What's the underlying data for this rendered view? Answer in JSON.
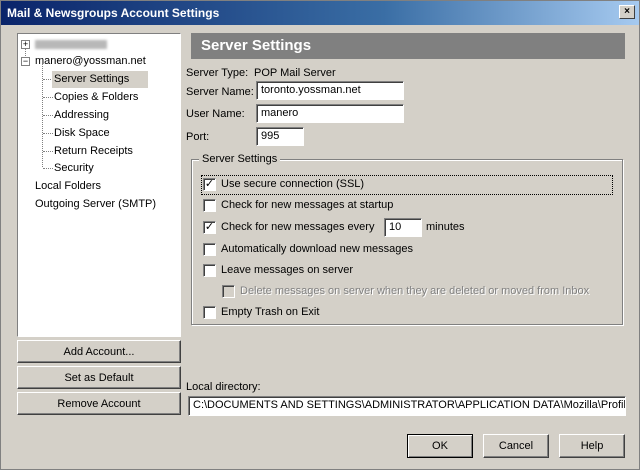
{
  "window": {
    "title": "Mail & Newsgroups Account Settings",
    "close_glyph": "×"
  },
  "tree": {
    "account_hidden": "",
    "account": "manero@yossman.net",
    "items": [
      {
        "label": "Server Settings",
        "selected": true
      },
      {
        "label": "Copies & Folders"
      },
      {
        "label": "Addressing"
      },
      {
        "label": "Disk Space"
      },
      {
        "label": "Return Receipts"
      },
      {
        "label": "Security"
      }
    ],
    "local_folders": "Local Folders",
    "outgoing_server": "Outgoing Server (SMTP)"
  },
  "left_buttons": {
    "add_account": "Add Account...",
    "set_default": "Set as Default",
    "remove_account": "Remove Account"
  },
  "panel": {
    "header": "Server Settings",
    "server_type_label": "Server Type:",
    "server_type_value": "POP Mail Server",
    "server_name_label": "Server Name:",
    "server_name_value": "toronto.yossman.net",
    "user_name_label": "User Name:",
    "user_name_value": "manero",
    "port_label": "Port:",
    "port_value": "995",
    "group_title": "Server Settings",
    "options": {
      "ssl": {
        "label": "Use secure connection (SSL)",
        "checked": true
      },
      "check_startup": {
        "label": "Check for new messages at startup",
        "checked": false
      },
      "check_every": {
        "label": "Check for new messages every",
        "checked": true,
        "minutes_value": "10",
        "minutes_suffix": "minutes"
      },
      "auto_download": {
        "label": "Automatically download new messages",
        "checked": false
      },
      "leave_on_server": {
        "label": "Leave messages on server",
        "checked": false
      },
      "delete_on_server": {
        "label": "Delete messages on server when they are deleted or moved from Inbox",
        "checked": false,
        "disabled": true
      },
      "empty_trash": {
        "label": "Empty Trash on Exit",
        "checked": false
      }
    },
    "local_directory_label": "Local directory:",
    "local_directory_value": "C:\\DOCUMENTS AND SETTINGS\\ADMINISTRATOR\\APPLICATION DATA\\Mozilla\\Profiles\\de"
  },
  "footer": {
    "ok": "OK",
    "cancel": "Cancel",
    "help": "Help"
  }
}
